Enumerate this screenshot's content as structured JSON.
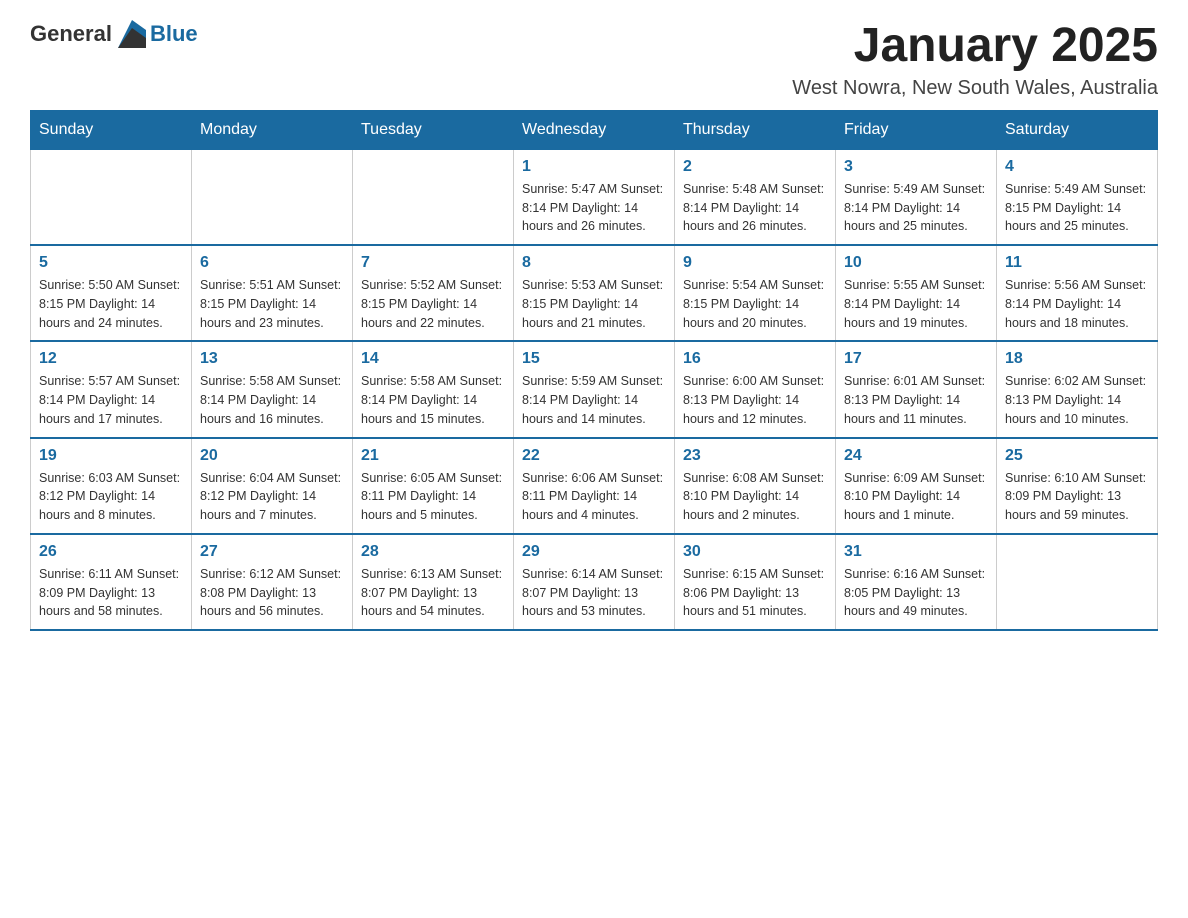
{
  "header": {
    "logo": {
      "general": "General",
      "blue": "Blue"
    },
    "title": "January 2025",
    "location": "West Nowra, New South Wales, Australia"
  },
  "days_of_week": [
    "Sunday",
    "Monday",
    "Tuesday",
    "Wednesday",
    "Thursday",
    "Friday",
    "Saturday"
  ],
  "weeks": [
    [
      {
        "day": "",
        "info": ""
      },
      {
        "day": "",
        "info": ""
      },
      {
        "day": "",
        "info": ""
      },
      {
        "day": "1",
        "info": "Sunrise: 5:47 AM\nSunset: 8:14 PM\nDaylight: 14 hours\nand 26 minutes."
      },
      {
        "day": "2",
        "info": "Sunrise: 5:48 AM\nSunset: 8:14 PM\nDaylight: 14 hours\nand 26 minutes."
      },
      {
        "day": "3",
        "info": "Sunrise: 5:49 AM\nSunset: 8:14 PM\nDaylight: 14 hours\nand 25 minutes."
      },
      {
        "day": "4",
        "info": "Sunrise: 5:49 AM\nSunset: 8:15 PM\nDaylight: 14 hours\nand 25 minutes."
      }
    ],
    [
      {
        "day": "5",
        "info": "Sunrise: 5:50 AM\nSunset: 8:15 PM\nDaylight: 14 hours\nand 24 minutes."
      },
      {
        "day": "6",
        "info": "Sunrise: 5:51 AM\nSunset: 8:15 PM\nDaylight: 14 hours\nand 23 minutes."
      },
      {
        "day": "7",
        "info": "Sunrise: 5:52 AM\nSunset: 8:15 PM\nDaylight: 14 hours\nand 22 minutes."
      },
      {
        "day": "8",
        "info": "Sunrise: 5:53 AM\nSunset: 8:15 PM\nDaylight: 14 hours\nand 21 minutes."
      },
      {
        "day": "9",
        "info": "Sunrise: 5:54 AM\nSunset: 8:15 PM\nDaylight: 14 hours\nand 20 minutes."
      },
      {
        "day": "10",
        "info": "Sunrise: 5:55 AM\nSunset: 8:14 PM\nDaylight: 14 hours\nand 19 minutes."
      },
      {
        "day": "11",
        "info": "Sunrise: 5:56 AM\nSunset: 8:14 PM\nDaylight: 14 hours\nand 18 minutes."
      }
    ],
    [
      {
        "day": "12",
        "info": "Sunrise: 5:57 AM\nSunset: 8:14 PM\nDaylight: 14 hours\nand 17 minutes."
      },
      {
        "day": "13",
        "info": "Sunrise: 5:58 AM\nSunset: 8:14 PM\nDaylight: 14 hours\nand 16 minutes."
      },
      {
        "day": "14",
        "info": "Sunrise: 5:58 AM\nSunset: 8:14 PM\nDaylight: 14 hours\nand 15 minutes."
      },
      {
        "day": "15",
        "info": "Sunrise: 5:59 AM\nSunset: 8:14 PM\nDaylight: 14 hours\nand 14 minutes."
      },
      {
        "day": "16",
        "info": "Sunrise: 6:00 AM\nSunset: 8:13 PM\nDaylight: 14 hours\nand 12 minutes."
      },
      {
        "day": "17",
        "info": "Sunrise: 6:01 AM\nSunset: 8:13 PM\nDaylight: 14 hours\nand 11 minutes."
      },
      {
        "day": "18",
        "info": "Sunrise: 6:02 AM\nSunset: 8:13 PM\nDaylight: 14 hours\nand 10 minutes."
      }
    ],
    [
      {
        "day": "19",
        "info": "Sunrise: 6:03 AM\nSunset: 8:12 PM\nDaylight: 14 hours\nand 8 minutes."
      },
      {
        "day": "20",
        "info": "Sunrise: 6:04 AM\nSunset: 8:12 PM\nDaylight: 14 hours\nand 7 minutes."
      },
      {
        "day": "21",
        "info": "Sunrise: 6:05 AM\nSunset: 8:11 PM\nDaylight: 14 hours\nand 5 minutes."
      },
      {
        "day": "22",
        "info": "Sunrise: 6:06 AM\nSunset: 8:11 PM\nDaylight: 14 hours\nand 4 minutes."
      },
      {
        "day": "23",
        "info": "Sunrise: 6:08 AM\nSunset: 8:10 PM\nDaylight: 14 hours\nand 2 minutes."
      },
      {
        "day": "24",
        "info": "Sunrise: 6:09 AM\nSunset: 8:10 PM\nDaylight: 14 hours\nand 1 minute."
      },
      {
        "day": "25",
        "info": "Sunrise: 6:10 AM\nSunset: 8:09 PM\nDaylight: 13 hours\nand 59 minutes."
      }
    ],
    [
      {
        "day": "26",
        "info": "Sunrise: 6:11 AM\nSunset: 8:09 PM\nDaylight: 13 hours\nand 58 minutes."
      },
      {
        "day": "27",
        "info": "Sunrise: 6:12 AM\nSunset: 8:08 PM\nDaylight: 13 hours\nand 56 minutes."
      },
      {
        "day": "28",
        "info": "Sunrise: 6:13 AM\nSunset: 8:07 PM\nDaylight: 13 hours\nand 54 minutes."
      },
      {
        "day": "29",
        "info": "Sunrise: 6:14 AM\nSunset: 8:07 PM\nDaylight: 13 hours\nand 53 minutes."
      },
      {
        "day": "30",
        "info": "Sunrise: 6:15 AM\nSunset: 8:06 PM\nDaylight: 13 hours\nand 51 minutes."
      },
      {
        "day": "31",
        "info": "Sunrise: 6:16 AM\nSunset: 8:05 PM\nDaylight: 13 hours\nand 49 minutes."
      },
      {
        "day": "",
        "info": ""
      }
    ]
  ]
}
